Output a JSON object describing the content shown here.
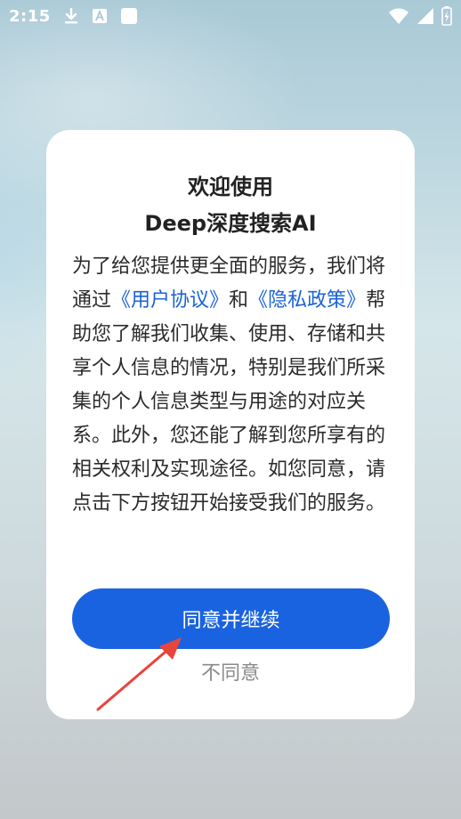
{
  "status_bar": {
    "time": "2:15",
    "icons": [
      "download-icon",
      "text-a-icon",
      "white-square-icon",
      "wifi-icon",
      "signal-icon",
      "battery-charging-icon"
    ]
  },
  "dialog": {
    "title_line1": "欢迎使用",
    "title_line2": "Deep深度搜索AI",
    "body": {
      "part1": "为了给您提供更全面的服务，我们将通过",
      "link_user_agreement": "《用户协议》",
      "part2": "和",
      "link_privacy_policy": "《隐私政策》",
      "part3": "帮助您了解我们收集、使用、存储和共享个人信息的情况，特别是我们所采集的个人信息类型与用途的对应关系。此外，您还能了解到您所享有的相关权利及实现途径。如您同意，请点击下方按钮开始接受我们的服务。"
    },
    "agree_button": "同意并继续",
    "disagree_link": "不同意"
  },
  "colors": {
    "accent": "#1a63e0",
    "link": "#1a63d6",
    "arrow": "#e8453c"
  }
}
